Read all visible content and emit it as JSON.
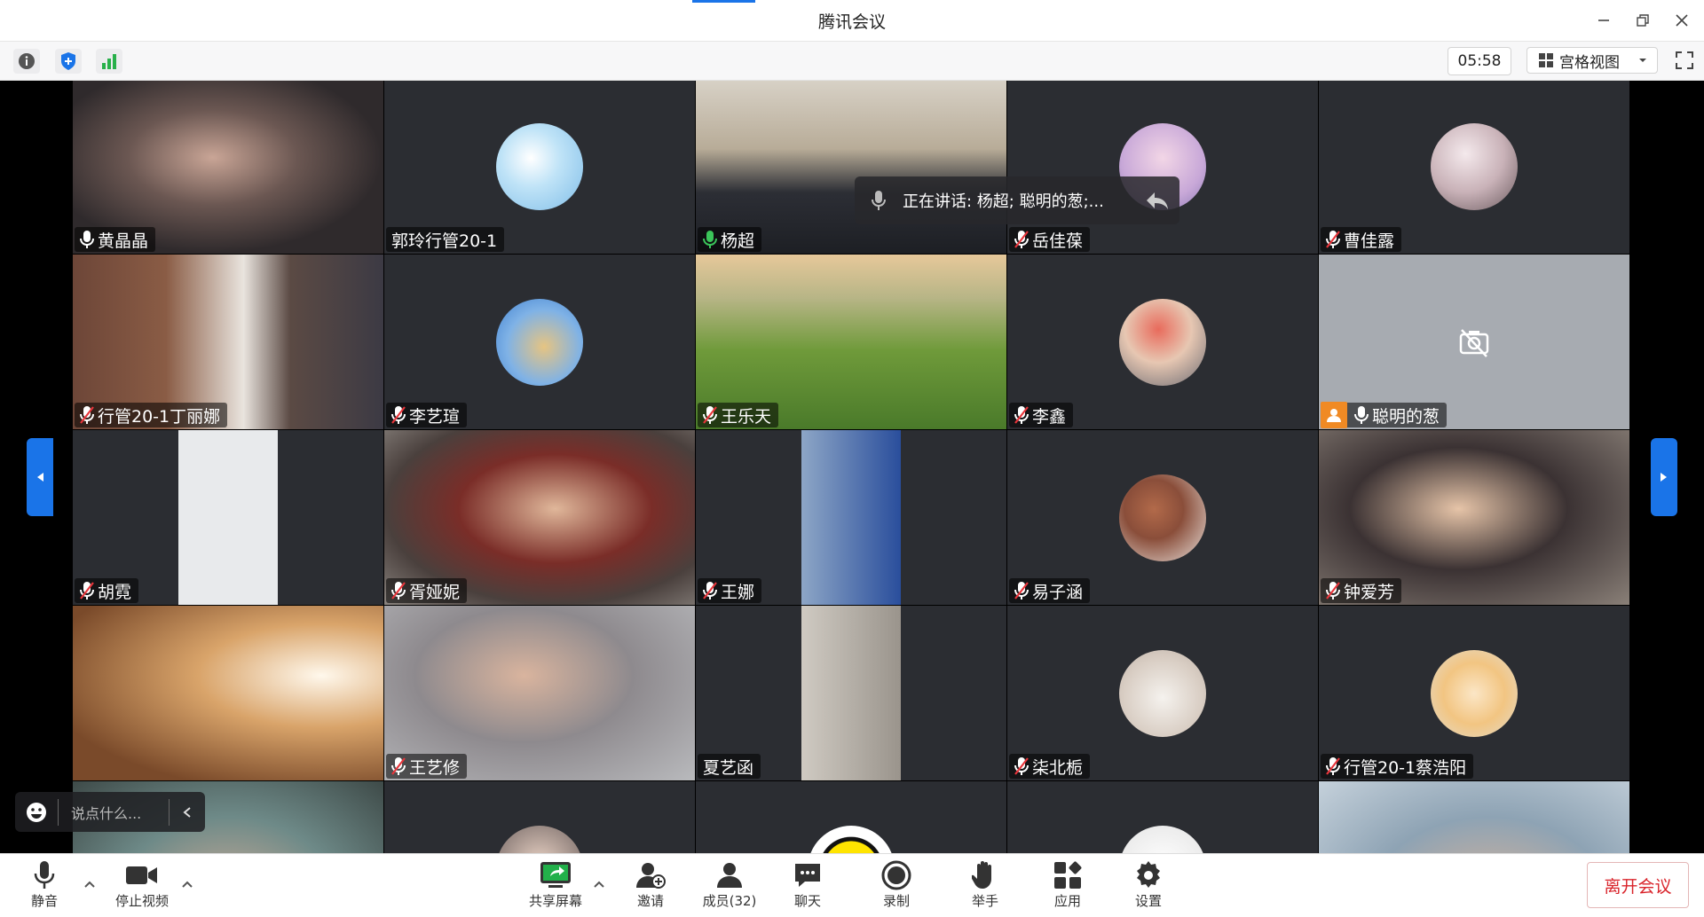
{
  "window": {
    "title": "腾讯会议"
  },
  "toolbar": {
    "timer": "05:58",
    "view_label": "宫格视图"
  },
  "speaking": {
    "text": "正在讲话: 杨超; 聪明的葱;..."
  },
  "chat": {
    "placeholder": "说点什么..."
  },
  "participants": [
    {
      "name": "黄晶晶",
      "mic": "on",
      "type": "video"
    },
    {
      "name": "郭玲行管20-1",
      "mic": "none",
      "type": "avatar"
    },
    {
      "name": "杨超",
      "mic": "speaking",
      "type": "video"
    },
    {
      "name": "岳佳葆",
      "mic": "muted",
      "type": "avatar"
    },
    {
      "name": "曹佳露",
      "mic": "muted",
      "type": "avatar"
    },
    {
      "name": "行管20-1丁丽娜",
      "mic": "muted",
      "type": "video"
    },
    {
      "name": "李艺瑄",
      "mic": "muted",
      "type": "avatar"
    },
    {
      "name": "王乐天",
      "mic": "muted",
      "type": "video"
    },
    {
      "name": "李鑫",
      "mic": "muted",
      "type": "avatar"
    },
    {
      "name": "聪明的葱",
      "mic": "on",
      "type": "camoff",
      "host": true
    },
    {
      "name": "胡霓",
      "mic": "muted",
      "type": "video"
    },
    {
      "name": "胥娅妮",
      "mic": "muted",
      "type": "video"
    },
    {
      "name": "王娜",
      "mic": "muted",
      "type": "video"
    },
    {
      "name": "易子涵",
      "mic": "muted",
      "type": "avatar"
    },
    {
      "name": "钟爱芳",
      "mic": "muted",
      "type": "video"
    },
    {
      "name": "",
      "mic": "none",
      "type": "video"
    },
    {
      "name": "王艺修",
      "mic": "muted",
      "type": "video"
    },
    {
      "name": "夏艺函",
      "mic": "none",
      "type": "video"
    },
    {
      "name": "柒北栀",
      "mic": "muted",
      "type": "avatar"
    },
    {
      "name": "行管20-1蔡浩阳",
      "mic": "muted",
      "type": "avatar"
    },
    {
      "name": "",
      "mic": "none",
      "type": "video"
    },
    {
      "name": "",
      "mic": "none",
      "type": "avatar"
    },
    {
      "name": "",
      "mic": "none",
      "type": "avatar"
    },
    {
      "name": "",
      "mic": "none",
      "type": "avatar"
    },
    {
      "name": "",
      "mic": "none",
      "type": "video"
    }
  ],
  "bottom": {
    "mute": "静音",
    "stop_video": "停止视频",
    "share": "共享屏幕",
    "invite": "邀请",
    "members": "成员(32)",
    "chat": "聊天",
    "record": "录制",
    "raise_hand": "举手",
    "apps": "应用",
    "settings": "设置",
    "leave": "离开会议"
  },
  "colors": {
    "accent": "#1a74e8",
    "speaking": "#3bc55a",
    "leave": "#d9232a",
    "host": "#f08a24"
  }
}
